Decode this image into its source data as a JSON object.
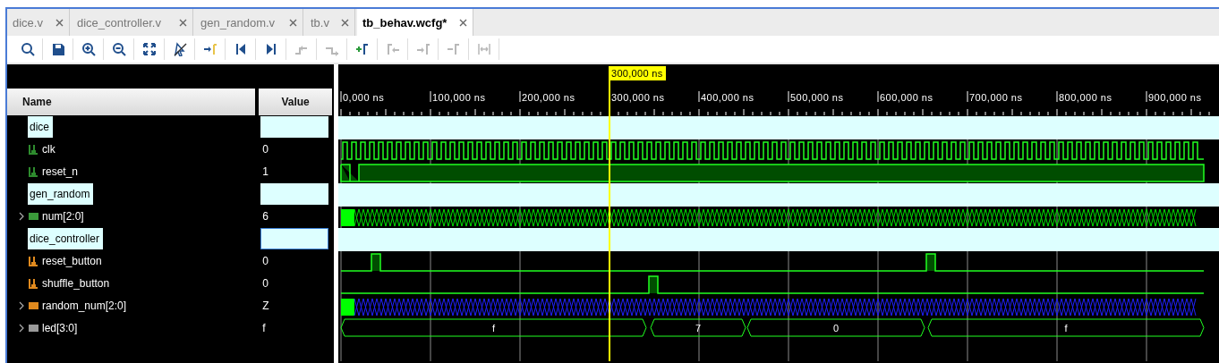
{
  "tabs": [
    {
      "label": "dice.v",
      "selected": false
    },
    {
      "label": "dice_controller.v",
      "selected": false
    },
    {
      "label": "gen_random.v",
      "selected": false
    },
    {
      "label": "tb.v",
      "selected": false
    },
    {
      "label": "tb_behav.wcfg*",
      "selected": true
    }
  ],
  "toolbar": [
    {
      "kind": "search",
      "disabled": false
    },
    {
      "kind": "save",
      "disabled": false
    },
    {
      "kind": "zoom_in",
      "disabled": false
    },
    {
      "kind": "zoom_out",
      "disabled": false
    },
    {
      "kind": "fit",
      "disabled": false
    },
    {
      "kind": "cursor_off",
      "disabled": false
    },
    {
      "kind": "go_cursor",
      "disabled": false
    },
    {
      "kind": "go_start",
      "disabled": false
    },
    {
      "kind": "go_end",
      "disabled": false
    },
    {
      "kind": "prev_transition",
      "disabled": true
    },
    {
      "kind": "next_transition",
      "disabled": true
    },
    {
      "kind": "add_marker",
      "disabled": false
    },
    {
      "kind": "prev_marker",
      "disabled": true
    },
    {
      "kind": "next_marker",
      "disabled": true
    },
    {
      "kind": "delete_marker",
      "disabled": true
    },
    {
      "kind": "swap_cursors",
      "disabled": true
    }
  ],
  "columns": [
    "Name",
    "Value"
  ],
  "ruler": {
    "ticks": [
      "0,000 ns",
      "100,000 ns",
      "200,000 ns",
      "300,000 ns",
      "400,000 ns",
      "500,000 ns",
      "600,000 ns",
      "700,000 ns",
      "800,000 ns",
      "900,000 ns"
    ],
    "cursor": "300,000 ns"
  },
  "signals": [
    {
      "kind": "group",
      "name": "dice",
      "selected": false
    },
    {
      "kind": "bit",
      "name": "clk",
      "value": "0",
      "color": "#2e8b2e"
    },
    {
      "kind": "bit",
      "name": "reset_n",
      "value": "1",
      "color": "#2e8b2e"
    },
    {
      "kind": "group",
      "name": "gen_random",
      "selected": false
    },
    {
      "kind": "bus",
      "name": "num[2:0]",
      "value": "6",
      "color": "#3a9a3a",
      "expanded": false
    },
    {
      "kind": "group",
      "name": "dice_controller",
      "selected": true
    },
    {
      "kind": "bit",
      "name": "reset_button",
      "value": "0",
      "color": "#e08a1e"
    },
    {
      "kind": "bit",
      "name": "shuffle_button",
      "value": "0",
      "color": "#e08a1e"
    },
    {
      "kind": "bus",
      "name": "random_num[2:0]",
      "value": "Z",
      "color": "#e08a1e",
      "expanded": false
    },
    {
      "kind": "bus",
      "name": "led[3:0]",
      "value": "f",
      "color": "#9a9a9a",
      "expanded": false,
      "segments": [
        {
          "label": "f"
        },
        {
          "label": "7"
        },
        {
          "label": "0"
        },
        {
          "label": "f"
        }
      ]
    }
  ]
}
